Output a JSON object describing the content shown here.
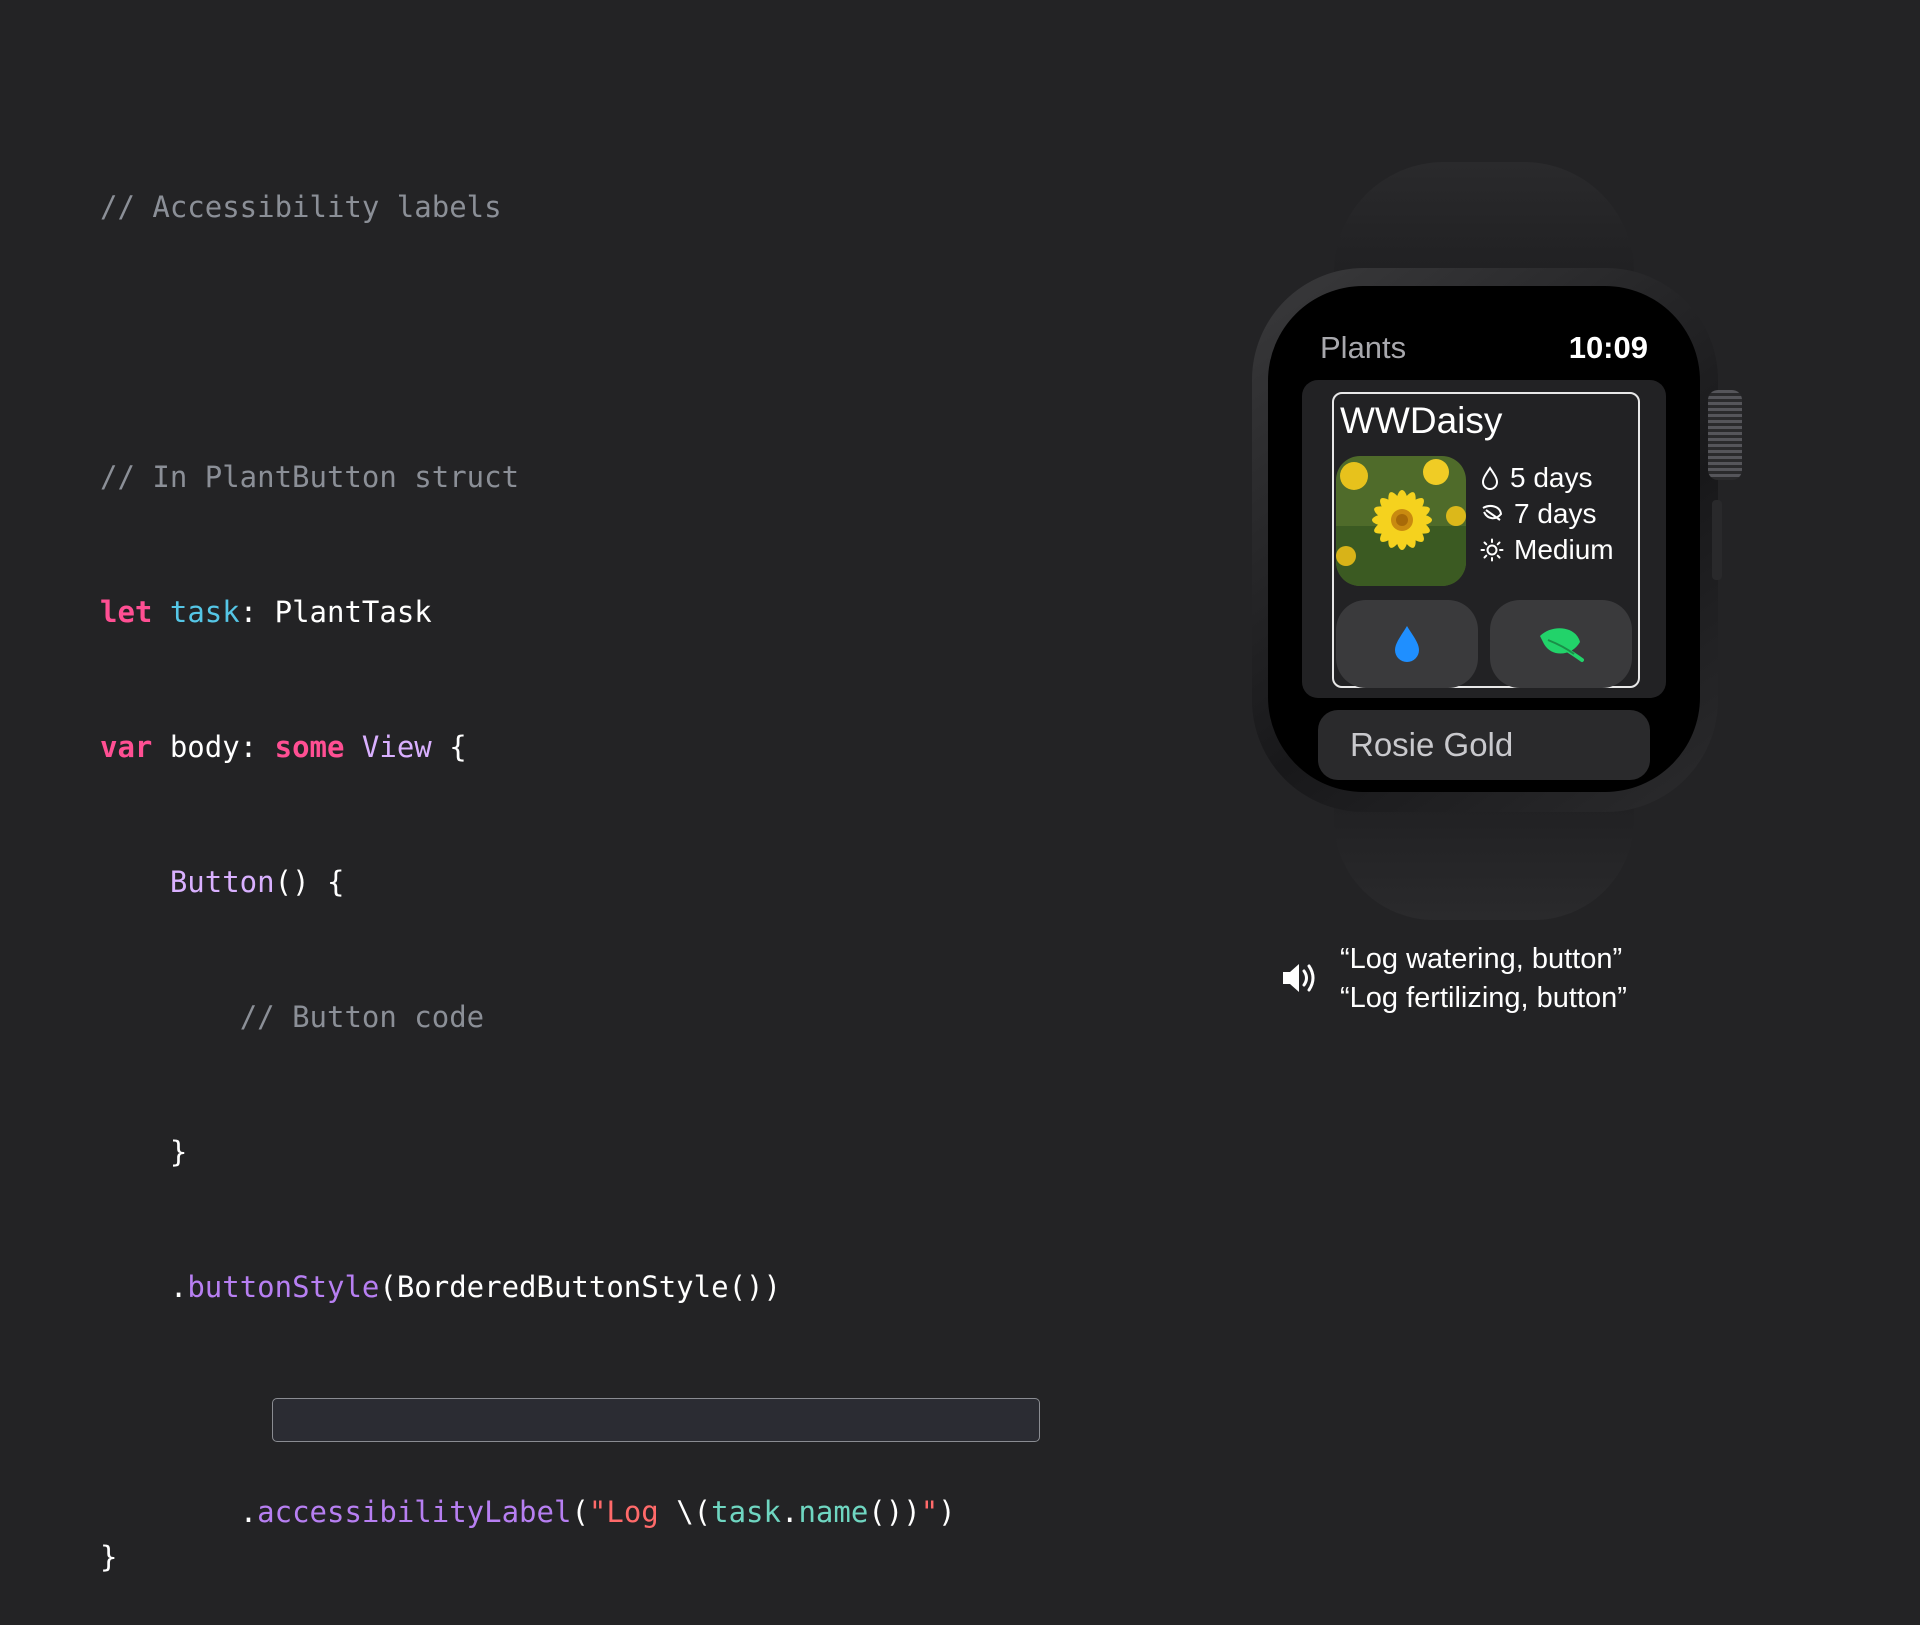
{
  "code": {
    "comment_title": "// Accessibility labels",
    "comment_struct": "// In PlantButton struct",
    "l1": {
      "kw": "let",
      "ident": "task",
      "rest": ": PlantTask"
    },
    "l2": {
      "kw": "var",
      "body": " body: ",
      "kw2": "some",
      "type": "View",
      "rest": " {"
    },
    "l3": {
      "indent": "    ",
      "type": "Button",
      "rest": "() {"
    },
    "l4": {
      "indent": "        ",
      "comment": "// Button code"
    },
    "l5": {
      "indent": "    ",
      "rest": "}"
    },
    "l6": {
      "indent": "    ",
      "dot": ".",
      "fn": "buttonStyle",
      "rest": "(BorderedButtonStyle())"
    },
    "l7": {
      "indent": "    ",
      "dot": ".",
      "fn": "accessibilityLabel",
      "open": "(",
      "str1": "\"Log ",
      "interp_open": "\\(",
      "task": "task",
      "dot2": ".",
      "name": "name",
      "parens": "())",
      "str2": "\"",
      "close": ")"
    },
    "l8": {
      "rest": "}"
    }
  },
  "watch": {
    "nav_title": "Plants",
    "time": "10:09",
    "plant": {
      "name": "WWDaisy",
      "water": "5 days",
      "fertilize": "7 days",
      "light": "Medium"
    },
    "next_plant": "Rosie Gold",
    "icons": [
      "droplet-icon",
      "leaf-icon",
      "sun-icon",
      "water-drop-icon",
      "fertilize-leaf-icon"
    ],
    "colors": {
      "water": "#1f8fff",
      "fertilize": "#22d36a"
    }
  },
  "speech": {
    "line1": "“Log watering, button”",
    "line2": "“Log fertilizing, button”"
  }
}
